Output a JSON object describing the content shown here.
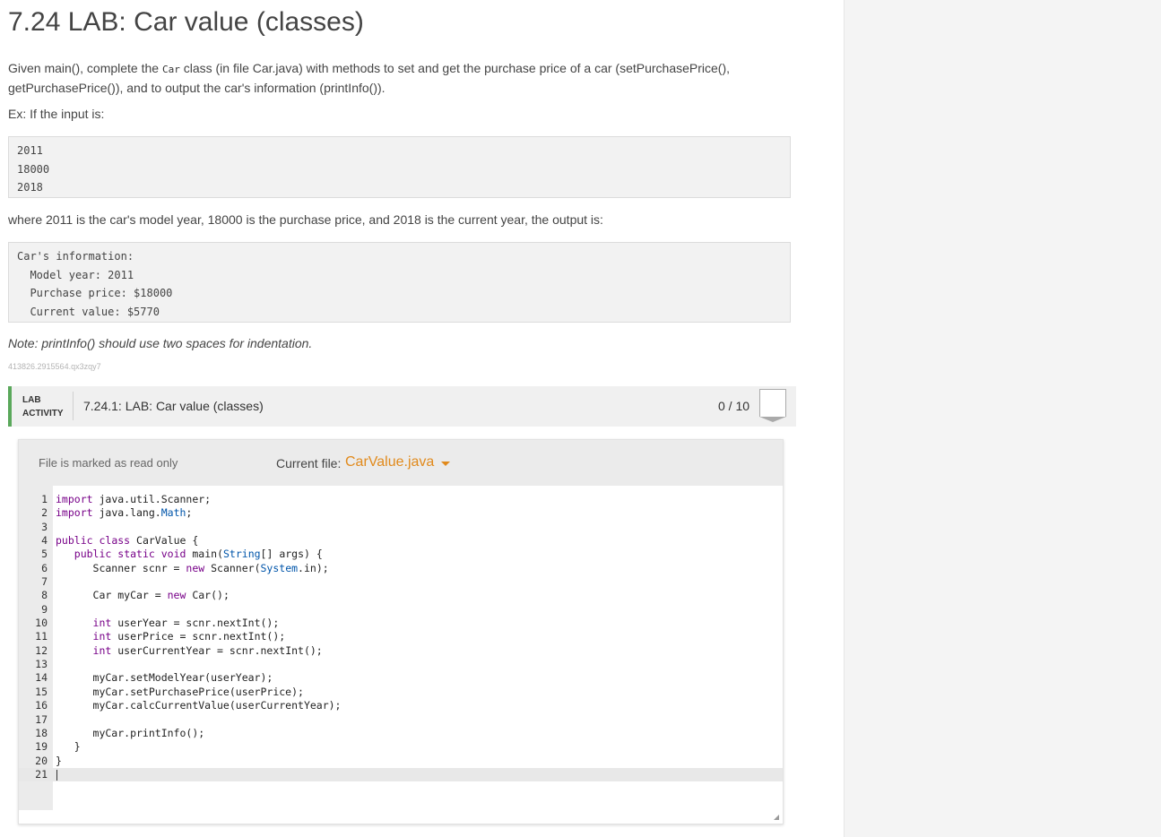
{
  "title": "7.24 LAB: Car value (classes)",
  "intro": {
    "part1": "Given main(), complete the ",
    "code": "Car",
    "part2": " class (in file Car.java) with methods to set and get the purchase price of a car (setPurchasePrice(), getPurchasePrice()), and to output the car's information (printInfo())."
  },
  "example_label": "Ex: If the input is:",
  "input_lines": [
    "2011",
    "18000",
    "2018"
  ],
  "explain": "where 2011 is the car's model year, 18000 is the purchase price, and 2018 is the current year, the output is:",
  "output_lines": [
    "Car's information:",
    "  Model year: 2011",
    "  Purchase price: $18000",
    "  Current value: $5770"
  ],
  "note": "Note: printInfo() should use two spaces for indentation.",
  "tracking_id": "413826.2915564.qx3zqy7",
  "lab": {
    "tag_line1": "LAB",
    "tag_line2": "ACTIVITY",
    "title": "7.24.1: LAB: Car value (classes)",
    "score": "0 / 10"
  },
  "editor": {
    "readonly_text": "File is marked as read only",
    "current_file_label": "Current file:",
    "current_file": "CarValue.java"
  },
  "code_lines": [
    "import java.util.Scanner;",
    "import java.lang.Math;",
    "",
    "public class CarValue {",
    "   public static void main(String[] args) {",
    "      Scanner scnr = new Scanner(System.in);",
    "",
    "      Car myCar = new Car();",
    "",
    "      int userYear = scnr.nextInt();",
    "      int userPrice = scnr.nextInt();",
    "      int userCurrentYear = scnr.nextInt();",
    "",
    "      myCar.setModelYear(userYear);",
    "      myCar.setPurchasePrice(userPrice);",
    "      myCar.calcCurrentValue(userCurrentYear);",
    "",
    "      myCar.printInfo();",
    "   }",
    "}",
    ""
  ]
}
